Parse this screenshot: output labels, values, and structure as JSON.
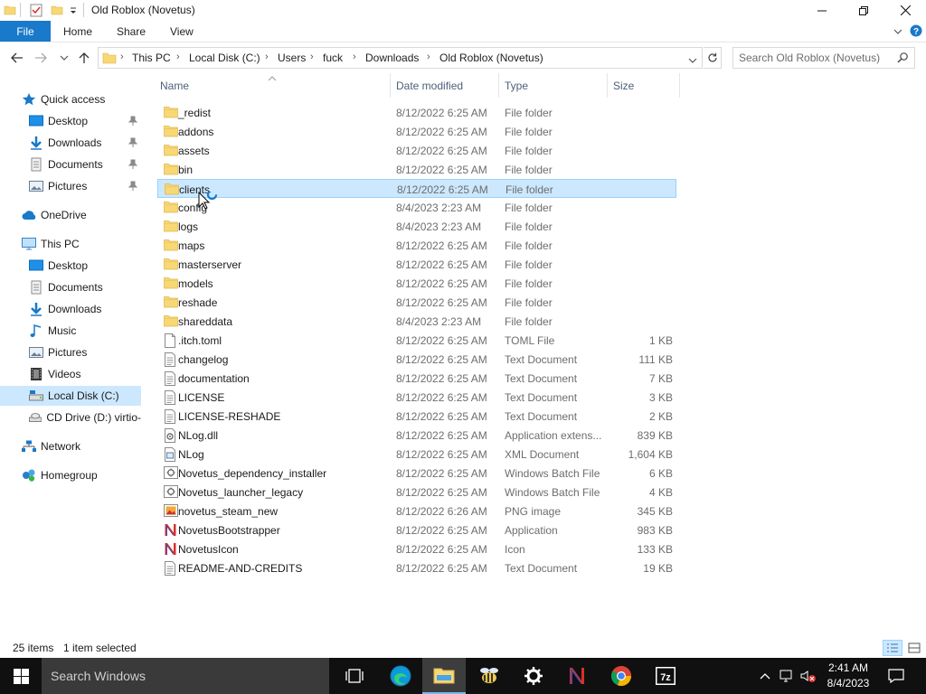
{
  "window": {
    "title": "Old Roblox (Novetus)"
  },
  "ribbon": {
    "tabs": [
      "File",
      "Home",
      "Share",
      "View"
    ]
  },
  "address": {
    "crumbs": [
      "This PC",
      "Local Disk (C:)",
      "Users",
      "fuck",
      "Downloads",
      "Old Roblox (Novetus)"
    ]
  },
  "search": {
    "placeholder": "Search Old Roblox (Novetus)"
  },
  "nav": {
    "items": [
      {
        "label": "Quick access",
        "icon": "star-icon"
      },
      {
        "label": "Desktop",
        "icon": "desktop-icon",
        "pinned": true
      },
      {
        "label": "Downloads",
        "icon": "download-arrow-icon",
        "pinned": true
      },
      {
        "label": "Documents",
        "icon": "documents-icon",
        "pinned": true
      },
      {
        "label": "Pictures",
        "icon": "pictures-icon",
        "pinned": true
      },
      {
        "label": "OneDrive",
        "icon": "cloud-icon"
      },
      {
        "label": "This PC",
        "icon": "computer-icon"
      },
      {
        "label": "Desktop",
        "icon": "desktop-icon"
      },
      {
        "label": "Documents",
        "icon": "documents-icon"
      },
      {
        "label": "Downloads",
        "icon": "download-arrow-icon"
      },
      {
        "label": "Music",
        "icon": "music-note-icon"
      },
      {
        "label": "Pictures",
        "icon": "pictures-icon"
      },
      {
        "label": "Videos",
        "icon": "film-icon"
      },
      {
        "label": "Local Disk (C:)",
        "icon": "drive-icon",
        "selected": true
      },
      {
        "label": "CD Drive (D:) virtio-",
        "icon": "cd-drive-icon"
      },
      {
        "label": "Network",
        "icon": "network-icon"
      },
      {
        "label": "Homegroup",
        "icon": "homegroup-icon"
      }
    ]
  },
  "columns": {
    "name": "Name",
    "date": "Date modified",
    "type": "Type",
    "size": "Size"
  },
  "files": [
    {
      "name": "_redist",
      "date": "8/12/2022 6:25 AM",
      "type": "File folder",
      "size": "",
      "icon": "folder-icon"
    },
    {
      "name": "addons",
      "date": "8/12/2022 6:25 AM",
      "type": "File folder",
      "size": "",
      "icon": "folder-icon"
    },
    {
      "name": "assets",
      "date": "8/12/2022 6:25 AM",
      "type": "File folder",
      "size": "",
      "icon": "folder-icon"
    },
    {
      "name": "bin",
      "date": "8/12/2022 6:25 AM",
      "type": "File folder",
      "size": "",
      "icon": "folder-icon"
    },
    {
      "name": "clients",
      "date": "8/12/2022 6:25 AM",
      "type": "File folder",
      "size": "",
      "icon": "folder-icon",
      "selected": true
    },
    {
      "name": "config",
      "date": "8/4/2023 2:23 AM",
      "type": "File folder",
      "size": "",
      "icon": "folder-icon"
    },
    {
      "name": "logs",
      "date": "8/4/2023 2:23 AM",
      "type": "File folder",
      "size": "",
      "icon": "folder-icon"
    },
    {
      "name": "maps",
      "date": "8/12/2022 6:25 AM",
      "type": "File folder",
      "size": "",
      "icon": "folder-icon"
    },
    {
      "name": "masterserver",
      "date": "8/12/2022 6:25 AM",
      "type": "File folder",
      "size": "",
      "icon": "folder-icon"
    },
    {
      "name": "models",
      "date": "8/12/2022 6:25 AM",
      "type": "File folder",
      "size": "",
      "icon": "folder-icon"
    },
    {
      "name": "reshade",
      "date": "8/12/2022 6:25 AM",
      "type": "File folder",
      "size": "",
      "icon": "folder-icon"
    },
    {
      "name": "shareddata",
      "date": "8/4/2023 2:23 AM",
      "type": "File folder",
      "size": "",
      "icon": "folder-icon"
    },
    {
      "name": ".itch.toml",
      "date": "8/12/2022 6:25 AM",
      "type": "TOML File",
      "size": "1 KB",
      "icon": "blank-file-icon"
    },
    {
      "name": "changelog",
      "date": "8/12/2022 6:25 AM",
      "type": "Text Document",
      "size": "111 KB",
      "icon": "text-file-icon"
    },
    {
      "name": "documentation",
      "date": "8/12/2022 6:25 AM",
      "type": "Text Document",
      "size": "7 KB",
      "icon": "text-file-icon"
    },
    {
      "name": "LICENSE",
      "date": "8/12/2022 6:25 AM",
      "type": "Text Document",
      "size": "3 KB",
      "icon": "text-file-icon"
    },
    {
      "name": "LICENSE-RESHADE",
      "date": "8/12/2022 6:25 AM",
      "type": "Text Document",
      "size": "2 KB",
      "icon": "text-file-icon"
    },
    {
      "name": "NLog.dll",
      "date": "8/12/2022 6:25 AM",
      "type": "Application extens...",
      "size": "839 KB",
      "icon": "dll-file-icon"
    },
    {
      "name": "NLog",
      "date": "8/12/2022 6:25 AM",
      "type": "XML Document",
      "size": "1,604 KB",
      "icon": "xml-file-icon"
    },
    {
      "name": "Novetus_dependency_installer",
      "date": "8/12/2022 6:25 AM",
      "type": "Windows Batch File",
      "size": "6 KB",
      "icon": "batch-file-icon"
    },
    {
      "name": "Novetus_launcher_legacy",
      "date": "8/12/2022 6:25 AM",
      "type": "Windows Batch File",
      "size": "4 KB",
      "icon": "batch-file-icon"
    },
    {
      "name": "novetus_steam_new",
      "date": "8/12/2022 6:26 AM",
      "type": "PNG image",
      "size": "345 KB",
      "icon": "image-file-icon"
    },
    {
      "name": "NovetusBootstrapper",
      "date": "8/12/2022 6:25 AM",
      "type": "Application",
      "size": "983 KB",
      "icon": "novetus-app-icon"
    },
    {
      "name": "NovetusIcon",
      "date": "8/12/2022 6:25 AM",
      "type": "Icon",
      "size": "133 KB",
      "icon": "novetus-app-icon"
    },
    {
      "name": "README-AND-CREDITS",
      "date": "8/12/2022 6:25 AM",
      "type": "Text Document",
      "size": "19 KB",
      "icon": "text-file-icon"
    }
  ],
  "status": {
    "count": "25 items",
    "selection": "1 item selected"
  },
  "taskbar": {
    "search_placeholder": "Search Windows",
    "time": "2:41 AM",
    "date": "8/4/2023"
  },
  "colors": {
    "accent": "#1979ca",
    "selection": "#cce8ff",
    "selection_border": "#99d1ff",
    "folder": "#f8d775",
    "taskbar": "#101010"
  }
}
